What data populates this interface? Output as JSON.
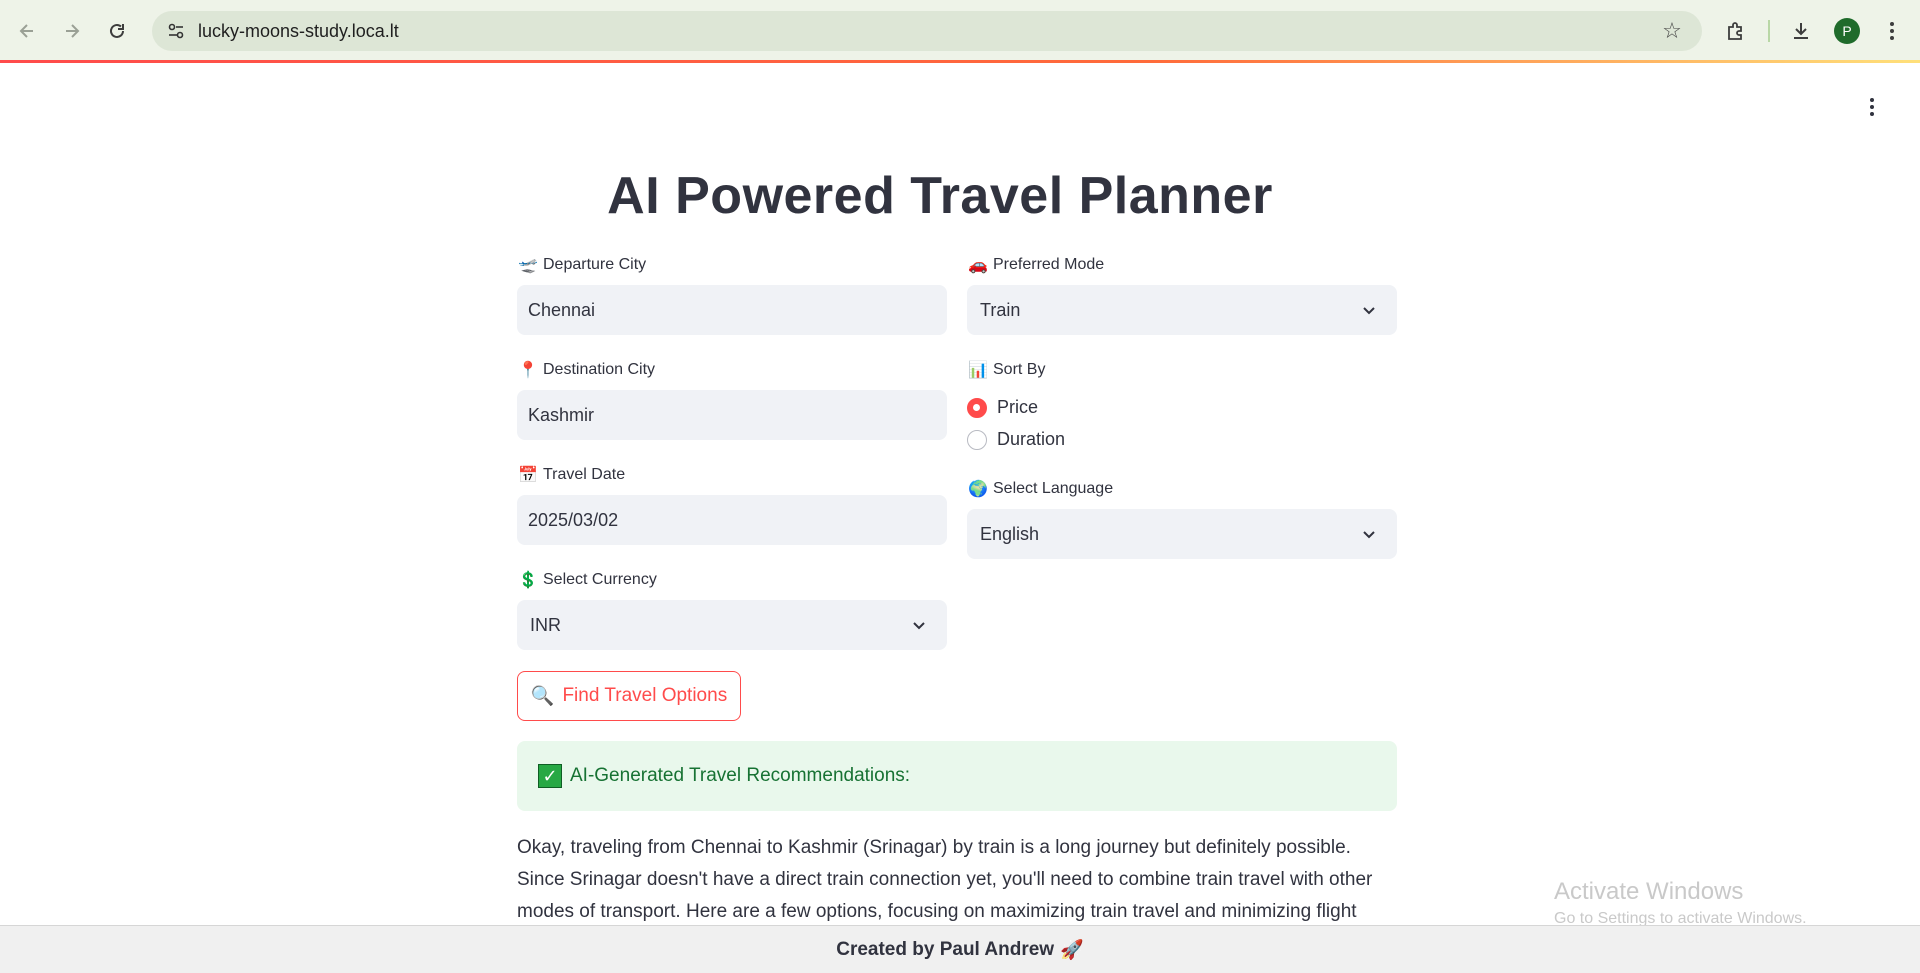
{
  "browser": {
    "url": "lucky-moons-study.loca.lt",
    "avatar_initial": "P"
  },
  "app": {
    "title": "AI Powered Travel Planner",
    "departure": {
      "label": "Departure City",
      "icon": "🛫",
      "value": "Chennai"
    },
    "destination": {
      "label": "Destination City",
      "icon": "📍",
      "value": "Kashmir"
    },
    "travel_date": {
      "label": "Travel Date",
      "icon": "📅",
      "value": "2025/03/02"
    },
    "currency": {
      "label": "Select Currency",
      "icon": "💲",
      "value": "INR"
    },
    "mode": {
      "label": "Preferred Mode",
      "icon": "🚗",
      "value": "Train"
    },
    "sort_by": {
      "label": "Sort By",
      "icon": "📊",
      "options": [
        "Price",
        "Duration"
      ],
      "selected": "Price"
    },
    "language": {
      "label": "Select Language",
      "icon": "🌍",
      "value": "English"
    },
    "find_button": {
      "label": "Find Travel Options",
      "icon": "🔍"
    },
    "result_banner": {
      "label": "AI-Generated Travel Recommendations:",
      "icon": "✓"
    },
    "result_text": "Okay, traveling from Chennai to Kashmir (Srinagar) by train is a long journey but definitely possible. Since Srinagar doesn't have a direct train connection yet, you'll need to combine train travel with other modes of transport. Here are a few options, focusing on maximizing train travel and minimizing flight costs:",
    "footer": {
      "text": "Created by Paul Andrew",
      "icon": "🚀"
    }
  },
  "os": {
    "watermark_line1": "Activate Windows",
    "watermark_line2": "Go to Settings to activate Windows."
  },
  "colors": {
    "accent": "#ff4b4b",
    "success_bg": "#e9f8ec",
    "success_text": "#177233",
    "input_bg": "#f0f2f6"
  }
}
